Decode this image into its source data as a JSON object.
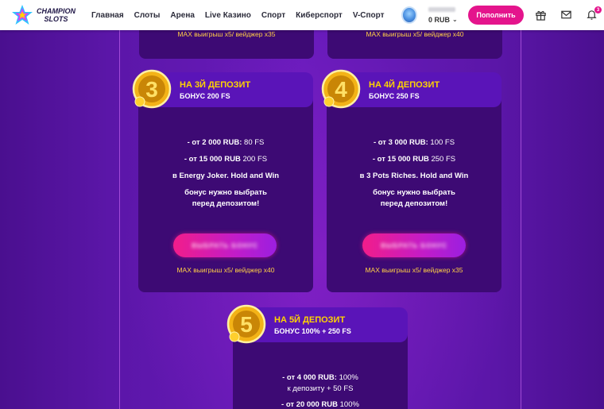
{
  "header": {
    "logo_line1": "CHAMPION",
    "logo_line2": "SLOTS",
    "nav": [
      "Главная",
      "Слоты",
      "Арена",
      "Live Казино",
      "Спорт",
      "Киберспорт",
      "V-Спорт"
    ],
    "balance": "0 RUB",
    "deposit_button": "Пополнить",
    "notification_count": "3"
  },
  "top_cards": [
    {
      "wager": "MAX выигрыш x5/ вейджер x35"
    },
    {
      "wager": "MAX выигрыш x5/ вейджер x40"
    }
  ],
  "cards": [
    {
      "number": "3",
      "title": "НА 3Й ДЕПОЗИТ",
      "subtitle": "БОНУС 200 FS",
      "line1_bold": "- от 2 000 RUB:",
      "line1_rest": " 80 FS",
      "line2_bold": "- от 15 000 RUB",
      "line2_rest": " 200 FS",
      "game": "в Energy Joker. Hold and Win",
      "note1": "бонус нужно выбрать",
      "note2": "перед депозитом!",
      "button": "ВЫБРАТЬ БОНУС",
      "wager": "MAX выигрыш x5/ вейджер x40"
    },
    {
      "number": "4",
      "title": "НА 4Й ДЕПОЗИТ",
      "subtitle": "БОНУС 250 FS",
      "line1_bold": "- от 3 000 RUB:",
      "line1_rest": " 100 FS",
      "line2_bold": "- от 15 000 RUB",
      "line2_rest": " 250 FS",
      "game": "в 3 Pots Riches. Hold and Win",
      "note1": "бонус нужно выбрать",
      "note2": "перед депозитом!",
      "button": "ВЫБРАТЬ БОНУС",
      "wager": "MAX выигрыш x5/ вейджер x35"
    },
    {
      "number": "5",
      "title": "НА 5Й ДЕПОЗИТ",
      "subtitle": "БОНУС 100% + 250 FS",
      "line1_bold": "- от 4 000 RUB:",
      "line1_rest": " 100%",
      "line1b": "к депозиту + 50 FS",
      "line2_bold": "- от 20 000 RUB",
      "line2_rest": " 100%"
    }
  ],
  "colors": {
    "accent": "#e4148c",
    "title_yellow": "#ffd400",
    "wager_text": "#ffcf45",
    "card_bg": "#3d0a74",
    "card_head": "#5a14b8"
  }
}
